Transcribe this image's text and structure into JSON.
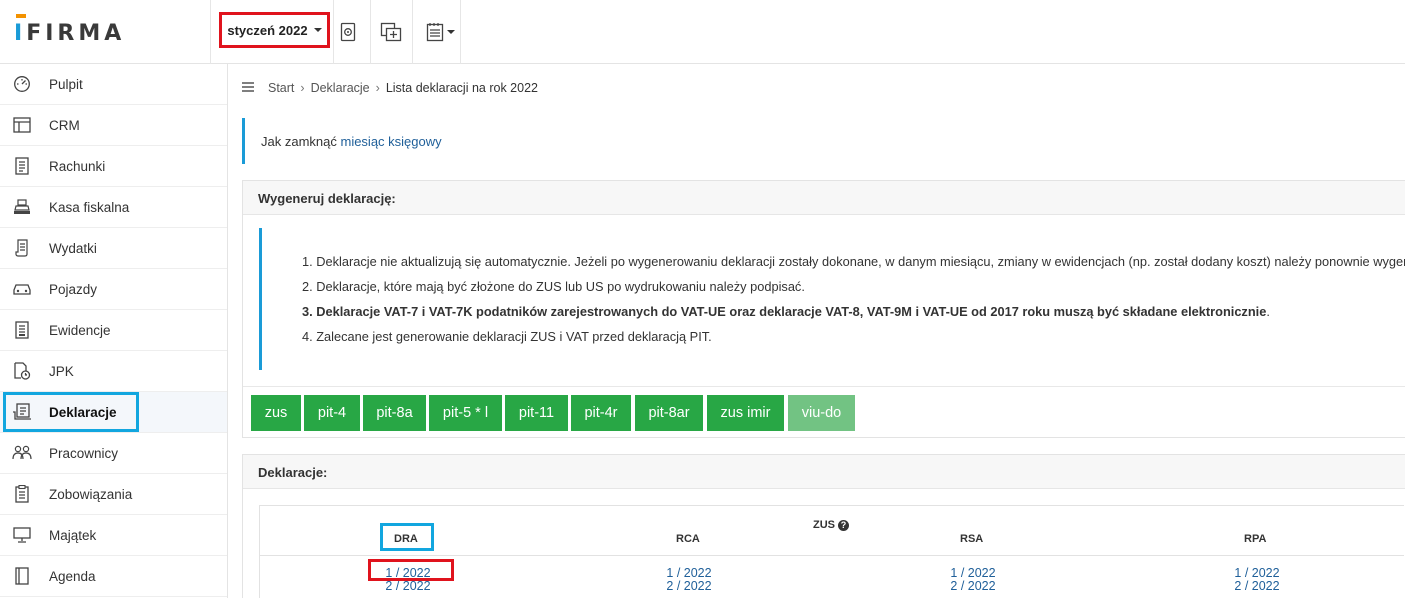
{
  "app": {
    "logo_text": "IFIRMA"
  },
  "topbar": {
    "month_label": "styczeń 2022",
    "icons": [
      "document-settings-icon",
      "add-copy-icon",
      "report-dropdown-icon"
    ]
  },
  "sidebar": {
    "items": [
      {
        "label": "Pulpit",
        "icon": "dashboard-icon"
      },
      {
        "label": "CRM",
        "icon": "crm-icon"
      },
      {
        "label": "Rachunki",
        "icon": "invoice-icon"
      },
      {
        "label": "Kasa fiskalna",
        "icon": "cash-register-icon"
      },
      {
        "label": "Wydatki",
        "icon": "expenses-icon"
      },
      {
        "label": "Pojazdy",
        "icon": "car-icon"
      },
      {
        "label": "Ewidencje",
        "icon": "records-icon"
      },
      {
        "label": "JPK",
        "icon": "jpk-icon"
      },
      {
        "label": "Deklaracje",
        "icon": "declarations-icon"
      },
      {
        "label": "Pracownicy",
        "icon": "employees-icon"
      },
      {
        "label": "Zobowiązania",
        "icon": "liabilities-icon"
      },
      {
        "label": "Majątek",
        "icon": "assets-icon"
      },
      {
        "label": "Agenda",
        "icon": "agenda-icon"
      }
    ],
    "active_index": 8
  },
  "breadcrumb": {
    "items": [
      "Start",
      "Deklaracje",
      "Lista deklaracji na rok 2022"
    ]
  },
  "info": {
    "text": "Jak zamknąć ",
    "link": "miesiąc księgowy"
  },
  "generate": {
    "title": "Wygeneruj deklarację:",
    "notes": [
      "1. Deklaracje nie aktualizują się automatycznie. Jeżeli po wygenerowaniu deklaracji zostały dokonane, w danym miesiącu, zmiany w ewidencjach (np. został dodany koszt) należy ponownie wygenerować",
      "2. Deklaracje, które mają być złożone do ZUS lub US po wydrukowaniu należy podpisać.",
      "3. Deklaracje VAT-7 i VAT-7K podatników zarejestrowanych do VAT-UE oraz deklaracje VAT-8, VAT-9M i VAT-UE od 2017 roku muszą być składane elektronicznie",
      "4. Zalecane jest generowanie deklaracji ZUS i VAT przed deklaracją PIT."
    ],
    "note3_suffix": ".",
    "buttons": [
      "zus",
      "pit-4",
      "pit-8a",
      "pit-5 * l",
      "pit-11",
      "pit-4r",
      "pit-8ar",
      "zus imir",
      "viu-do"
    ]
  },
  "declarations": {
    "title": "Deklaracje:",
    "group_label": "ZUS",
    "help_icon": "question-circle-icon",
    "columns": [
      "DRA",
      "RCA",
      "RSA",
      "RPA"
    ],
    "rows": [
      [
        "1 / 2022",
        "1 / 2022",
        "1 / 2022",
        "1 / 2022"
      ],
      [
        "2 / 2022",
        "2 / 2022",
        "2 / 2022",
        "2 / 2022"
      ]
    ]
  },
  "colors": {
    "highlight_red": "#e0131d",
    "highlight_blue": "#12a6df",
    "button_green": "#28a745",
    "button_green_disabled": "#72c383",
    "link_blue": "#1f5f99",
    "accent_blue": "#1a9bd7",
    "logo_orange": "#f39200"
  }
}
